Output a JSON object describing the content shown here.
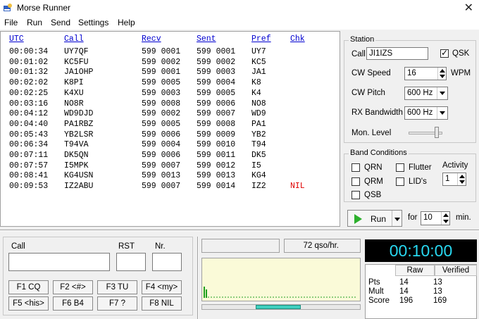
{
  "window": {
    "title": "Morse Runner",
    "close_glyph": "✕"
  },
  "menu": [
    "File",
    "Run",
    "Send",
    "Settings",
    "Help"
  ],
  "log": {
    "headers": {
      "utc": "UTC",
      "call": "Call",
      "recv": "Recv",
      "sent": "Sent",
      "pref": "Pref",
      "chk": "Chk"
    },
    "rows": [
      {
        "utc": "00:00:34",
        "call": "UY7QF",
        "recv": "599 0001",
        "sent": "599 0001",
        "pref": "UY7",
        "chk": ""
      },
      {
        "utc": "00:01:02",
        "call": "KC5FU",
        "recv": "599 0002",
        "sent": "599 0002",
        "pref": "KC5",
        "chk": ""
      },
      {
        "utc": "00:01:32",
        "call": "JA1OHP",
        "recv": "599 0001",
        "sent": "599 0003",
        "pref": "JA1",
        "chk": ""
      },
      {
        "utc": "00:02:02",
        "call": "K8PI",
        "recv": "599 0005",
        "sent": "599 0004",
        "pref": "K8",
        "chk": ""
      },
      {
        "utc": "00:02:25",
        "call": "K4XU",
        "recv": "599 0003",
        "sent": "599 0005",
        "pref": "K4",
        "chk": ""
      },
      {
        "utc": "00:03:16",
        "call": "NO8R",
        "recv": "599 0008",
        "sent": "599 0006",
        "pref": "NO8",
        "chk": ""
      },
      {
        "utc": "00:04:12",
        "call": "WD9DJD",
        "recv": "599 0002",
        "sent": "599 0007",
        "pref": "WD9",
        "chk": ""
      },
      {
        "utc": "00:04:40",
        "call": "PA1RBZ",
        "recv": "599 0005",
        "sent": "599 0008",
        "pref": "PA1",
        "chk": ""
      },
      {
        "utc": "00:05:43",
        "call": "YB2LSR",
        "recv": "599 0006",
        "sent": "599 0009",
        "pref": "YB2",
        "chk": ""
      },
      {
        "utc": "00:06:34",
        "call": "T94VA",
        "recv": "599 0004",
        "sent": "599 0010",
        "pref": "T94",
        "chk": ""
      },
      {
        "utc": "00:07:11",
        "call": "DK5QN",
        "recv": "599 0006",
        "sent": "599 0011",
        "pref": "DK5",
        "chk": ""
      },
      {
        "utc": "00:07:57",
        "call": "I5MPK",
        "recv": "599 0007",
        "sent": "599 0012",
        "pref": "I5",
        "chk": ""
      },
      {
        "utc": "00:08:41",
        "call": "KG4USN",
        "recv": "599 0013",
        "sent": "599 0013",
        "pref": "KG4",
        "chk": ""
      },
      {
        "utc": "00:09:53",
        "call": "IZ2ABU",
        "recv": "599 0007",
        "sent": "599 0014",
        "pref": "IZ2",
        "chk": "NIL"
      }
    ]
  },
  "station": {
    "title": "Station",
    "call_label": "Call",
    "call_value": "JI1IZS",
    "qsk_label": "QSK",
    "qsk_checked": true,
    "cw_speed_label": "CW Speed",
    "cw_speed_value": "16",
    "wpm_label": "WPM",
    "cw_pitch_label": "CW Pitch",
    "cw_pitch_value": "600 Hz",
    "rx_bw_label": "RX Bandwidth",
    "rx_bw_value": "600 Hz",
    "mon_level_label": "Mon. Level",
    "mon_level": 0.8
  },
  "band": {
    "title": "Band Conditions",
    "qrn": "QRN",
    "qrm": "QRM",
    "qsb": "QSB",
    "flutter": "Flutter",
    "lids": "LID's",
    "activity_label": "Activity",
    "activity_value": "1"
  },
  "run": {
    "run_label": "Run",
    "for_label": "for",
    "minutes_value": "10",
    "min_label": "min."
  },
  "entry": {
    "call_label": "Call",
    "rst_label": "RST",
    "nr_label": "Nr.",
    "fkeys": [
      "F1 CQ",
      "F2 <#>",
      "F3 TU",
      "F4 <my>",
      "F5 <his>",
      "F6 B4",
      "F7 ?",
      "F8 NIL"
    ]
  },
  "status": {
    "rate": "72 qso/hr."
  },
  "clock": "00:10:00",
  "score": {
    "raw_label": "Raw",
    "verified_label": "Verified",
    "rows": [
      {
        "label": "Pts",
        "raw": "14",
        "verified": "13"
      },
      {
        "label": "Mult",
        "raw": "14",
        "verified": "13"
      },
      {
        "label": "Score",
        "raw": "196",
        "verified": "169"
      }
    ]
  },
  "colors": {
    "clock_bg": "#000000",
    "clock_fg": "#28d8f0",
    "header_blue": "#0000d0",
    "nil_red": "#e00000",
    "graph_bg": "#fafad8",
    "graph_bar": "#20a020"
  }
}
